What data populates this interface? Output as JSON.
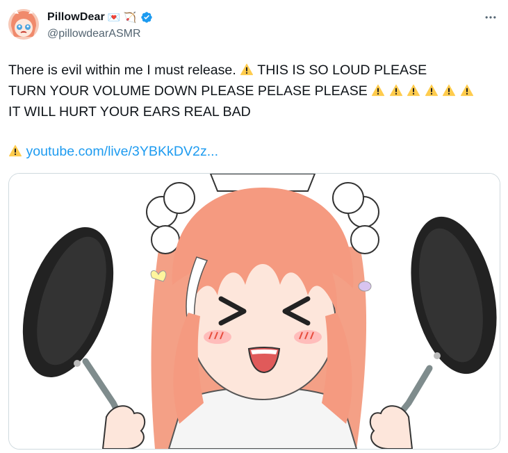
{
  "post": {
    "author": {
      "display_name": "PillowDear",
      "name_emojis": [
        "💌",
        "🏹"
      ],
      "handle": "@pillowdearASMR",
      "verified": true,
      "avatar_icon": "anime-girl-avatar"
    },
    "text_line1": "There is evil within me I must release. ",
    "text_line1b": " THIS IS SO LOUD PLEASE",
    "text_line2": "TURN YOUR VOLUME DOWN PLEASE PELASE PLEASE ",
    "text_line3": "IT WILL HURT YOUR EARS REAL BAD",
    "link_text": "youtube.com/live/3YBKkDV2z...",
    "warning_icon": "warning-sign-icon",
    "warning_count_line2": 6,
    "media": {
      "description_icon": "anime-girl-with-frying-pans-image"
    }
  },
  "colors": {
    "text": "#0f1419",
    "secondary": "#536471",
    "link": "#1d9bf0",
    "verified": "#1d9bf0",
    "warning": "#ffcc4d",
    "border": "#cfd9de"
  }
}
